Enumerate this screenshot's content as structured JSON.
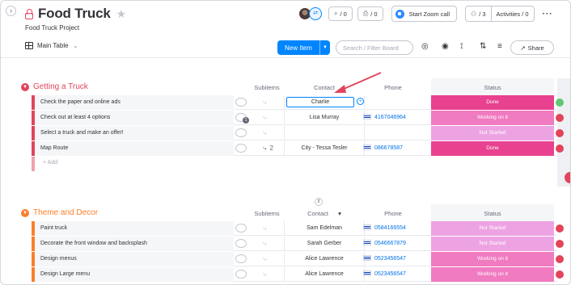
{
  "board": {
    "title": "Food Truck",
    "subtitle": "Food Truck Project"
  },
  "header": {
    "invite_icon": "invite-icon",
    "updates_count": "/ 0",
    "activity_count": "/ 0",
    "zoom_label": "Start Zoom call",
    "members_count": "/ 3",
    "activities_label": "Activities / 0",
    "more_icon": "more-icon"
  },
  "toolbar": {
    "view_label": "Main Table",
    "new_item_label": "New Item",
    "search_placeholder": "Search / Filter Board",
    "share_label": "Share"
  },
  "colors": {
    "done": "#e8418f",
    "working": "#f07bc0",
    "not_started": "#eda3e2",
    "group1": "#e2445c",
    "group2": "#fb7f2c",
    "link": "#0073ea"
  },
  "groups": [
    {
      "name": "Getting a Truck",
      "color": "#e2445c",
      "headers": {
        "subitems": "Subitems",
        "contact": "Contact",
        "phone": "Phone",
        "status": "Status"
      },
      "rows": [
        {
          "name": "Check the paper and online ads",
          "contact": "Charlie",
          "phone": "",
          "status": "Done",
          "status_color": "#e8418f",
          "right": "#60c873",
          "editing": true
        },
        {
          "name": "Check out at least 4 options",
          "contact": "Lisa Murray",
          "phone": "4167046964",
          "status": "Working on it",
          "status_color": "#f07bc0",
          "right": "#e2445c",
          "badge": true
        },
        {
          "name": "Select a truck and make an offer!",
          "contact": "",
          "phone": "",
          "status": "Not Started",
          "status_color": "#eda3e2",
          "right": "#e2445c"
        },
        {
          "name": "Map Route",
          "contact": "City - Tessa Tesler",
          "phone": "086678587",
          "status": "Done",
          "status_color": "#e8418f",
          "right": "#e2445c",
          "subitems": "2"
        }
      ],
      "add_label": "+ Add"
    },
    {
      "name": "Theme and Decor",
      "color": "#fb7f2c",
      "headers": {
        "subitems": "Subitems",
        "contact": "Contact",
        "phone": "Phone",
        "status": "Status"
      },
      "rows": [
        {
          "name": "Paint truck",
          "contact": "Sam Edelman",
          "phone": "0584166554",
          "status": "Not Started",
          "status_color": "#eda3e2",
          "right": "#e2445c"
        },
        {
          "name": "Decorate the front window and backsplash",
          "contact": "Sarah Gerber",
          "phone": "0546667879",
          "status": "Not Started",
          "status_color": "#eda3e2",
          "right": "#e2445c"
        },
        {
          "name": "Design menus",
          "contact": "Alice Lawrence",
          "phone": "0523456547",
          "status": "Working on it",
          "status_color": "#f07bc0",
          "right": "#e2445c"
        },
        {
          "name": "Design Large menu",
          "contact": "Alice Lawrence",
          "phone": "0523456547",
          "status": "Working on it",
          "status_color": "#f07bc0",
          "right": "#e2445c"
        }
      ]
    }
  ]
}
